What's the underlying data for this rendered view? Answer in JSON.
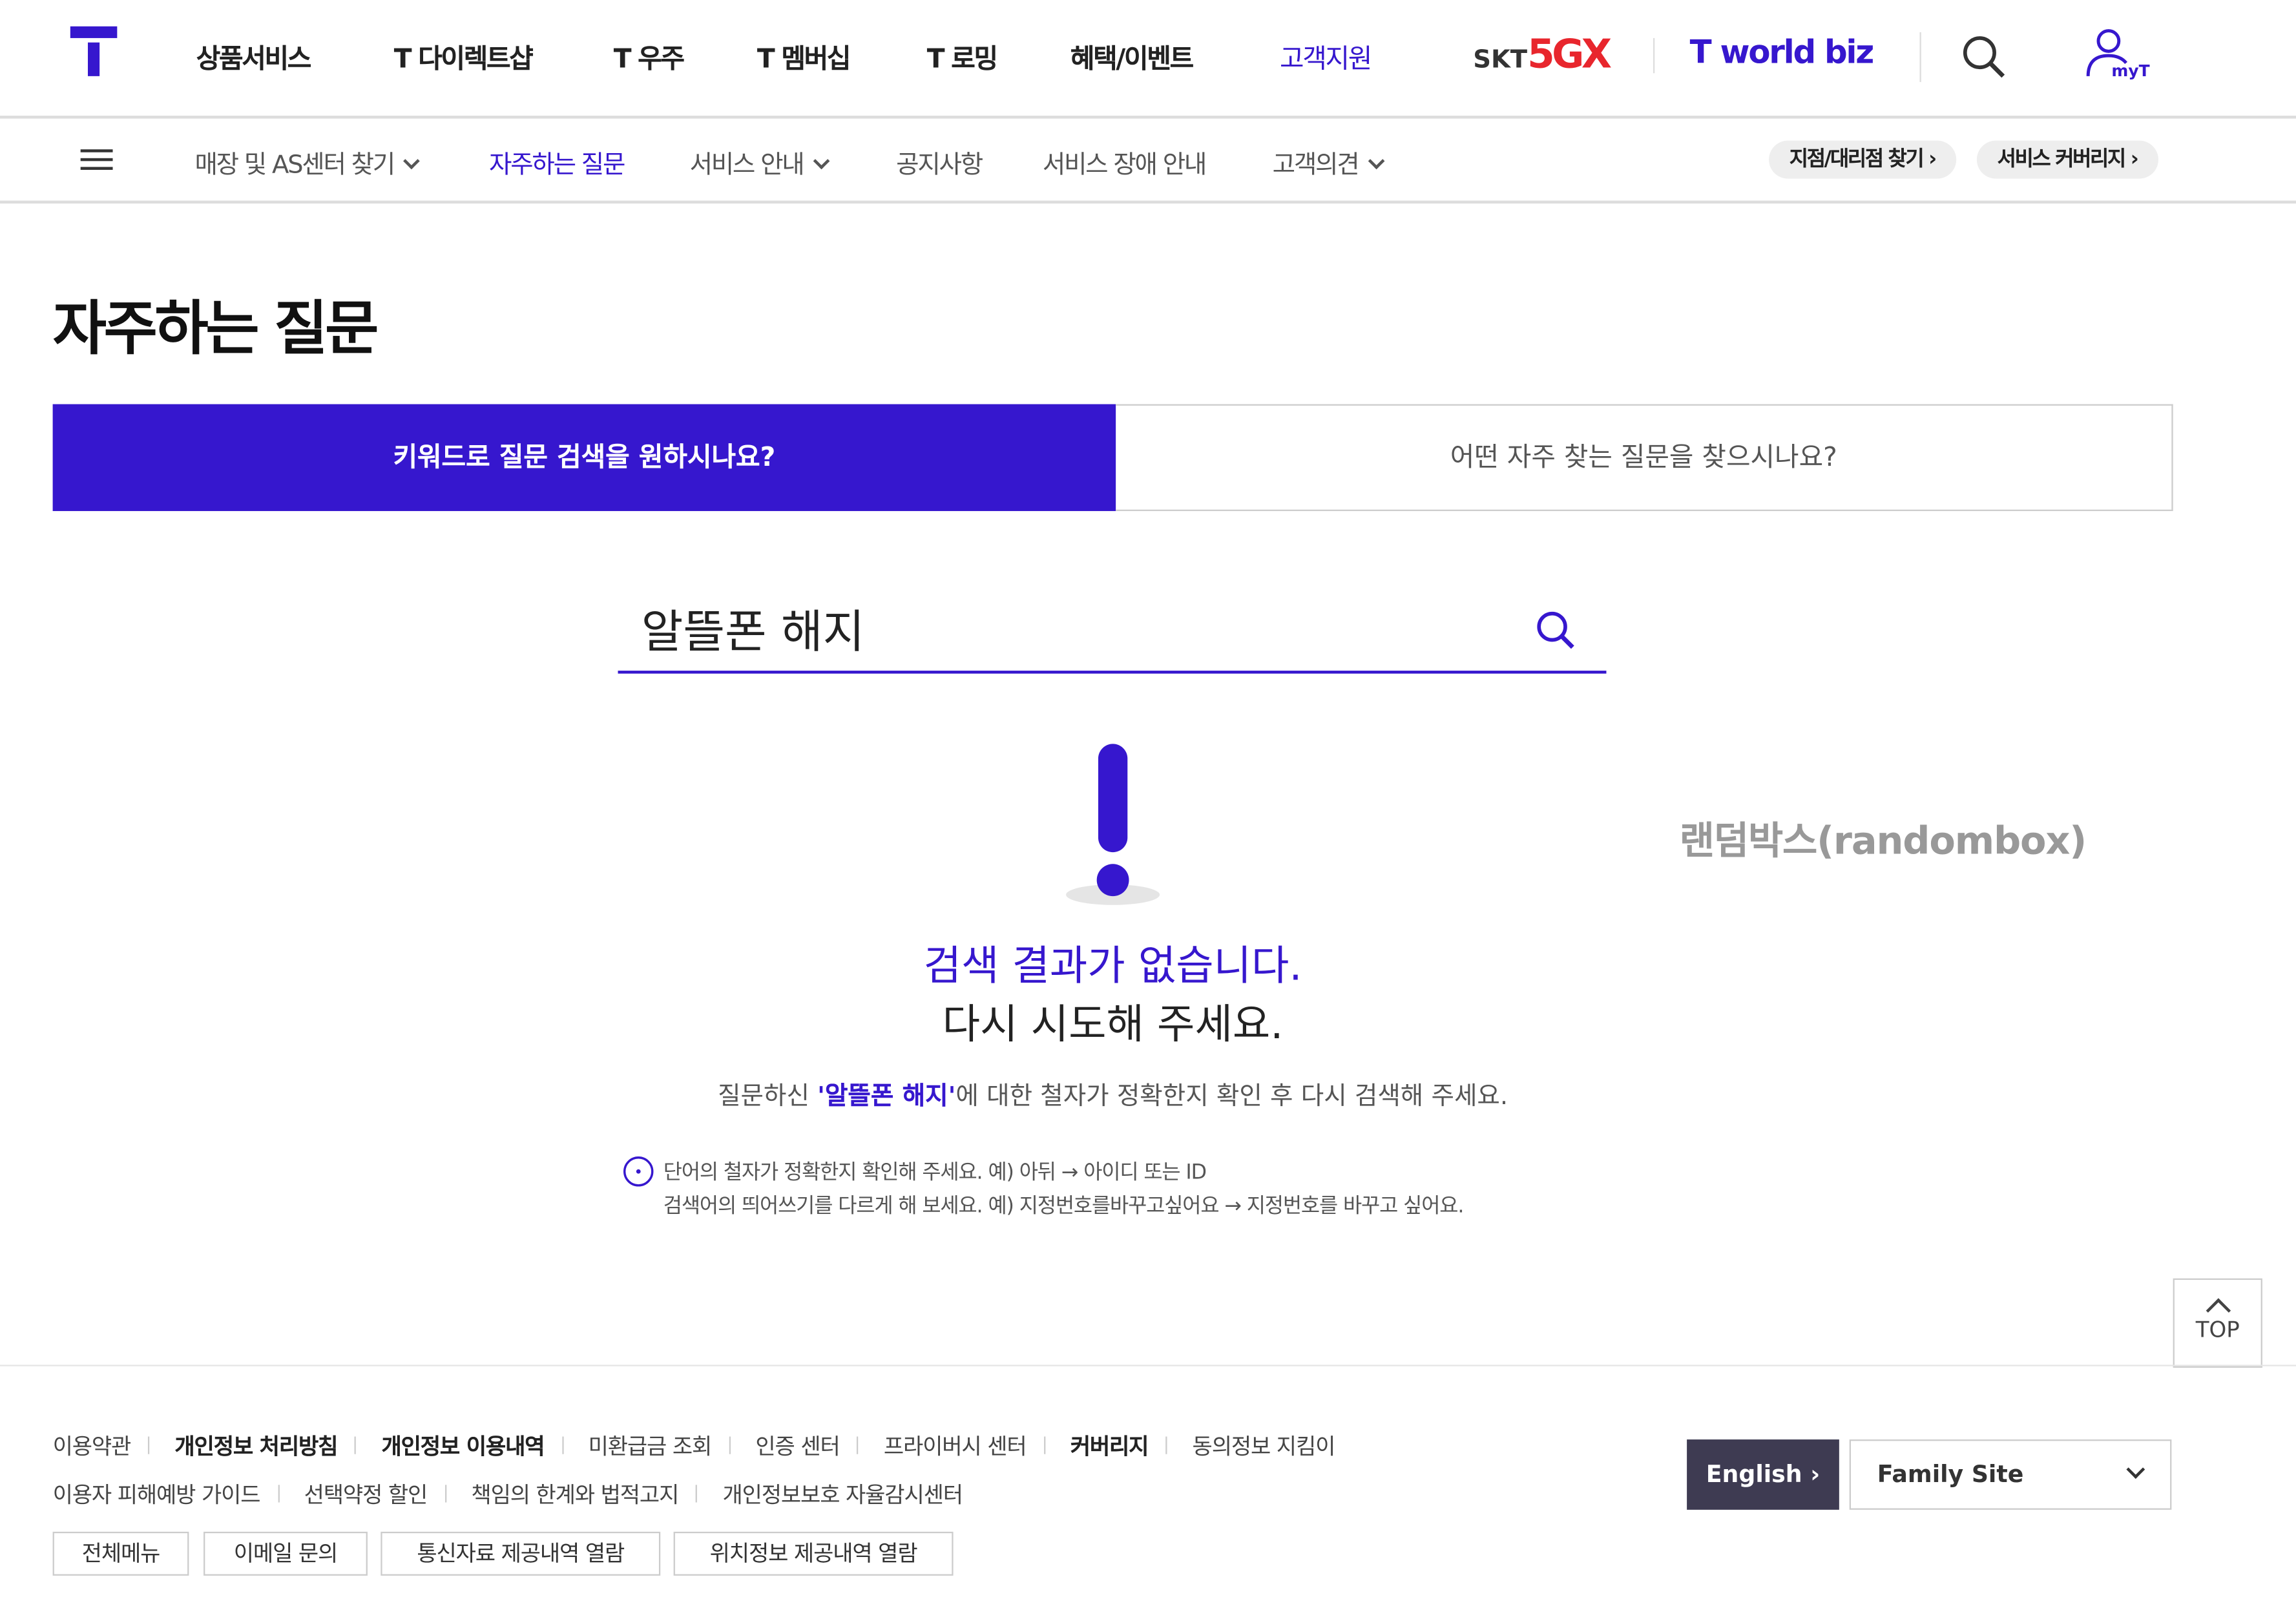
{
  "header": {
    "logo": "T",
    "nav": [
      "상품서비스",
      "T 다이렉트샵",
      "T 우주",
      "T 멤버십",
      "T 로밍",
      "혜택/이벤트",
      "고객지원"
    ],
    "active_nav": "고객지원",
    "brand_5gx": {
      "skt": "SKT",
      "mark": "5GX"
    },
    "biz_logo": "T world biz",
    "myt_label": "myT",
    "accent": "#3617CE"
  },
  "subnav": {
    "items": [
      {
        "label": "매장 및 AS센터 찾기",
        "dropdown": true
      },
      {
        "label": "자주하는 질문",
        "dropdown": false,
        "active": true
      },
      {
        "label": "서비스 안내",
        "dropdown": true
      },
      {
        "label": "공지사항",
        "dropdown": false
      },
      {
        "label": "서비스 장애 안내",
        "dropdown": false
      },
      {
        "label": "고객의견",
        "dropdown": true
      }
    ],
    "pills": [
      "지점/대리점 찾기",
      "서비스 커버리지"
    ]
  },
  "page": {
    "title": "자주하는 질문",
    "tabs": [
      "키워드로 질문 검색을 원하시나요?",
      "어떤 자주 찾는 질문을 찾으시나요?"
    ],
    "search_value": "알뜰폰 해지",
    "no_result": {
      "line1": "검색 결과가 없습니다.",
      "line2": "다시 시도해 주세요.",
      "desc_pre": "질문하신 ",
      "desc_keyword": "'알뜰폰 해지'",
      "desc_post": "에 대한 철자가 정확한지 확인 후 다시 검색해 주세요.",
      "tip1": "단어의 철자가 정확한지 확인해 주세요. 예) 아뒤 → 아이디 또는 ID",
      "tip2": "검색어의 띄어쓰기를 다르게 해 보세요. 예) 지정번호를바꾸고싶어요 → 지정번호를 바꾸고 싶어요."
    },
    "randombox": "랜덤박스(randombox)",
    "top_label": "TOP"
  },
  "footer": {
    "row1": [
      {
        "t": "이용약관",
        "b": false
      },
      {
        "t": "개인정보 처리방침",
        "b": true
      },
      {
        "t": "개인정보 이용내역",
        "b": true
      },
      {
        "t": "미환급금 조회",
        "b": false
      },
      {
        "t": "인증 센터",
        "b": false
      },
      {
        "t": "프라이버시 센터",
        "b": false
      },
      {
        "t": "커버리지",
        "b": true
      },
      {
        "t": "동의정보 지킴이",
        "b": false
      }
    ],
    "row2": [
      "이용자 피해예방 가이드",
      "선택약정 할인",
      "책임의 한계와 법적고지",
      "개인정보보호 자율감시센터"
    ],
    "buttons": [
      "전체메뉴",
      "이메일 문의",
      "통신자료 제공내역 열람",
      "위치정보 제공내역 열람"
    ],
    "english": "English",
    "family_site": "Family Site"
  }
}
